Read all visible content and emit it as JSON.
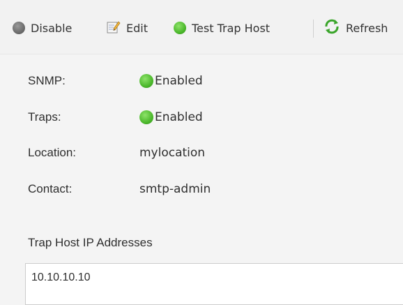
{
  "toolbar": {
    "disable_label": "Disable",
    "edit_label": "Edit",
    "test_trap_host_label": "Test Trap Host",
    "refresh_label": "Refresh"
  },
  "properties": [
    {
      "label": "SNMP:",
      "value": "Enabled",
      "status": "enabled"
    },
    {
      "label": "Traps:",
      "value": "Enabled",
      "status": "enabled"
    },
    {
      "label": "Location:",
      "value": "mylocation"
    },
    {
      "label": "Contact:",
      "value": "smtp-admin"
    }
  ],
  "trap_hosts": {
    "title": "Trap Host IP Addresses",
    "items": [
      "10.10.10.10"
    ]
  },
  "colors": {
    "status_enabled": "#4cb82c",
    "disabled_gray": "#6c6c6c",
    "refresh_green": "#3aa52a"
  },
  "icons": {
    "disable": "gray-circle-icon",
    "edit": "edit-pencil-icon",
    "test": "green-circle-icon",
    "refresh": "refresh-arrows-icon",
    "status": "green-status-icon"
  }
}
